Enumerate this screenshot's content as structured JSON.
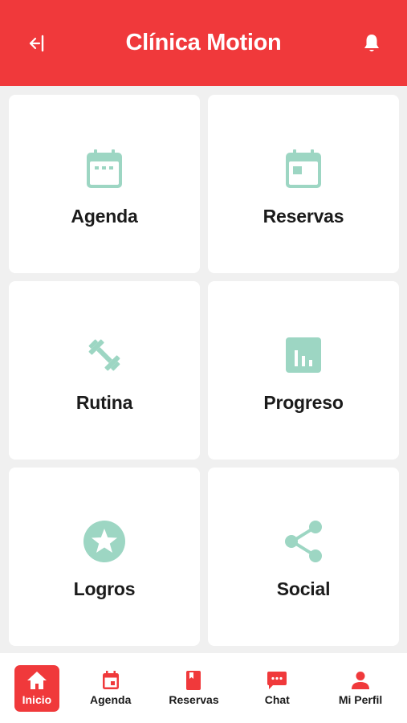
{
  "header": {
    "title": "Clínica Motion",
    "back_icon": "logout-arrow-icon",
    "bell_icon": "bell-icon"
  },
  "colors": {
    "brand": "#f0393b",
    "accent_icon": "#9dd6c3",
    "tile_bg": "#ffffff",
    "page_bg": "#f0f0f0"
  },
  "tiles": [
    {
      "label": "Agenda",
      "icon": "calendar-icon"
    },
    {
      "label": "Reservas",
      "icon": "calendar-event-icon"
    },
    {
      "label": "Rutina",
      "icon": "dumbbell-icon"
    },
    {
      "label": "Progreso",
      "icon": "bar-chart-icon"
    },
    {
      "label": "Logros",
      "icon": "star-circle-icon"
    },
    {
      "label": "Social",
      "icon": "share-icon"
    }
  ],
  "nav": [
    {
      "label": "Inicio",
      "icon": "home-icon",
      "active": true
    },
    {
      "label": "Agenda",
      "icon": "calendar-icon"
    },
    {
      "label": "Reservas",
      "icon": "bookmark-book-icon"
    },
    {
      "label": "Chat",
      "icon": "chat-icon"
    },
    {
      "label": "Mi Perfil",
      "icon": "person-icon"
    }
  ]
}
